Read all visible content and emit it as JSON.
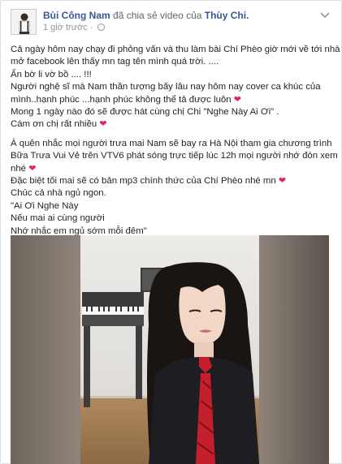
{
  "post": {
    "author": "Bùi Công Nam",
    "action": "đã chia sẻ video của",
    "target": "Thùy Chi.",
    "time": "1 giờ trước ·",
    "privacy_icon": "globe-icon"
  },
  "content": {
    "lines": [
      "Cả ngày hôm nay chạy đi phỏng vấn và thu làm bài Chí Phèo giờ mới về tới nhà",
      "mở facebook lên thấy mn tag tên mình quá trời. ....",
      "Ẩn bờ li vờ bồ .... !!!",
      "Người nghệ sĩ mà Nam thần tượng bấy lâu nay hôm nay cover ca khúc của",
      "mình..hạnh phúc ...hạnh phúc không thể tả được luôn",
      "Mong 1 ngày nào đó sẽ được hát cùng chị Chi \"Nghe Này Ai Ơi\" .",
      "Cám ơn chị rất nhiều",
      "À quên nhắc mọi người trưa mai Nam sẽ bay ra Hà Nội tham gia chương trình",
      "Bữa Trưa Vui Vẻ trên VTV6 phát sóng trực tiếp lúc 12h mọi người nhớ đón xem",
      "nhé",
      "Đặc biệt tối mai sẽ có bản mp3 chính thức của Chí Phèo nhé mn",
      "Chúc cả nhà ngủ ngon.",
      "\"Ai Ơi Nghe Này",
      "Nếu mai ai cùng người",
      "Nhớ nhắc em ngủ sớm mỗi đêm\""
    ],
    "heart_emoji": "❤"
  },
  "colors": {
    "link": "#365899",
    "meta": "#90949c",
    "heart": "#e0245e"
  }
}
